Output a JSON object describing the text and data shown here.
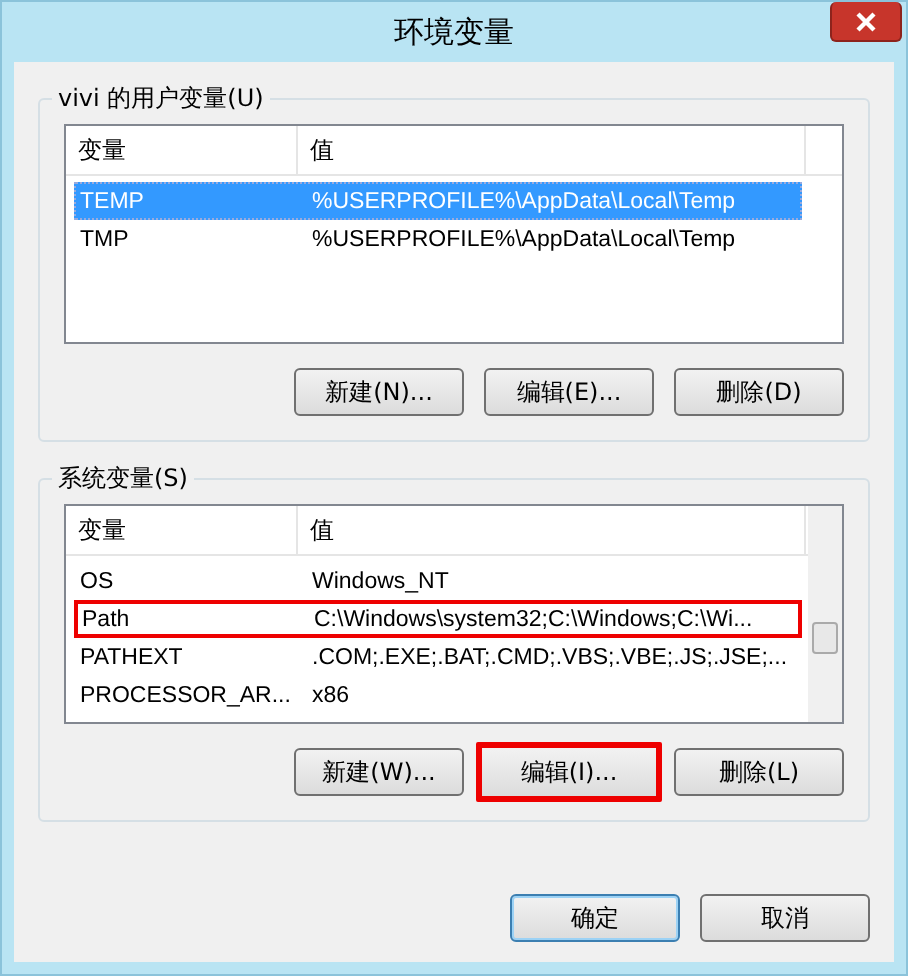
{
  "window": {
    "title": "环境变量"
  },
  "user_vars": {
    "label": "vivi 的用户变量(U)",
    "columns": [
      "变量",
      "值"
    ],
    "rows": [
      {
        "name": "TEMP",
        "value": "%USERPROFILE%\\AppData\\Local\\Temp",
        "selected": true,
        "highlighted": false
      },
      {
        "name": "TMP",
        "value": "%USERPROFILE%\\AppData\\Local\\Temp",
        "selected": false,
        "highlighted": false
      }
    ],
    "buttons": [
      {
        "label": "新建(N)...",
        "highlighted": false
      },
      {
        "label": "编辑(E)...",
        "highlighted": false
      },
      {
        "label": "删除(D)",
        "highlighted": false
      }
    ]
  },
  "system_vars": {
    "label": "系统变量(S)",
    "columns": [
      "变量",
      "值"
    ],
    "rows": [
      {
        "name": "OS",
        "value": "Windows_NT",
        "selected": false,
        "highlighted": false
      },
      {
        "name": "Path",
        "value": "C:\\Windows\\system32;C:\\Windows;C:\\Wi...",
        "selected": false,
        "highlighted": true
      },
      {
        "name": "PATHEXT",
        "value": ".COM;.EXE;.BAT;.CMD;.VBS;.VBE;.JS;.JSE;...",
        "selected": false,
        "highlighted": false
      },
      {
        "name": "PROCESSOR_AR...",
        "value": "x86",
        "selected": false,
        "highlighted": false
      }
    ],
    "buttons": [
      {
        "label": "新建(W)...",
        "highlighted": false
      },
      {
        "label": "编辑(I)...",
        "highlighted": true
      },
      {
        "label": "删除(L)",
        "highlighted": false
      }
    ]
  },
  "dialog_buttons": [
    {
      "label": "确定",
      "default": true
    },
    {
      "label": "取消",
      "default": false
    }
  ]
}
